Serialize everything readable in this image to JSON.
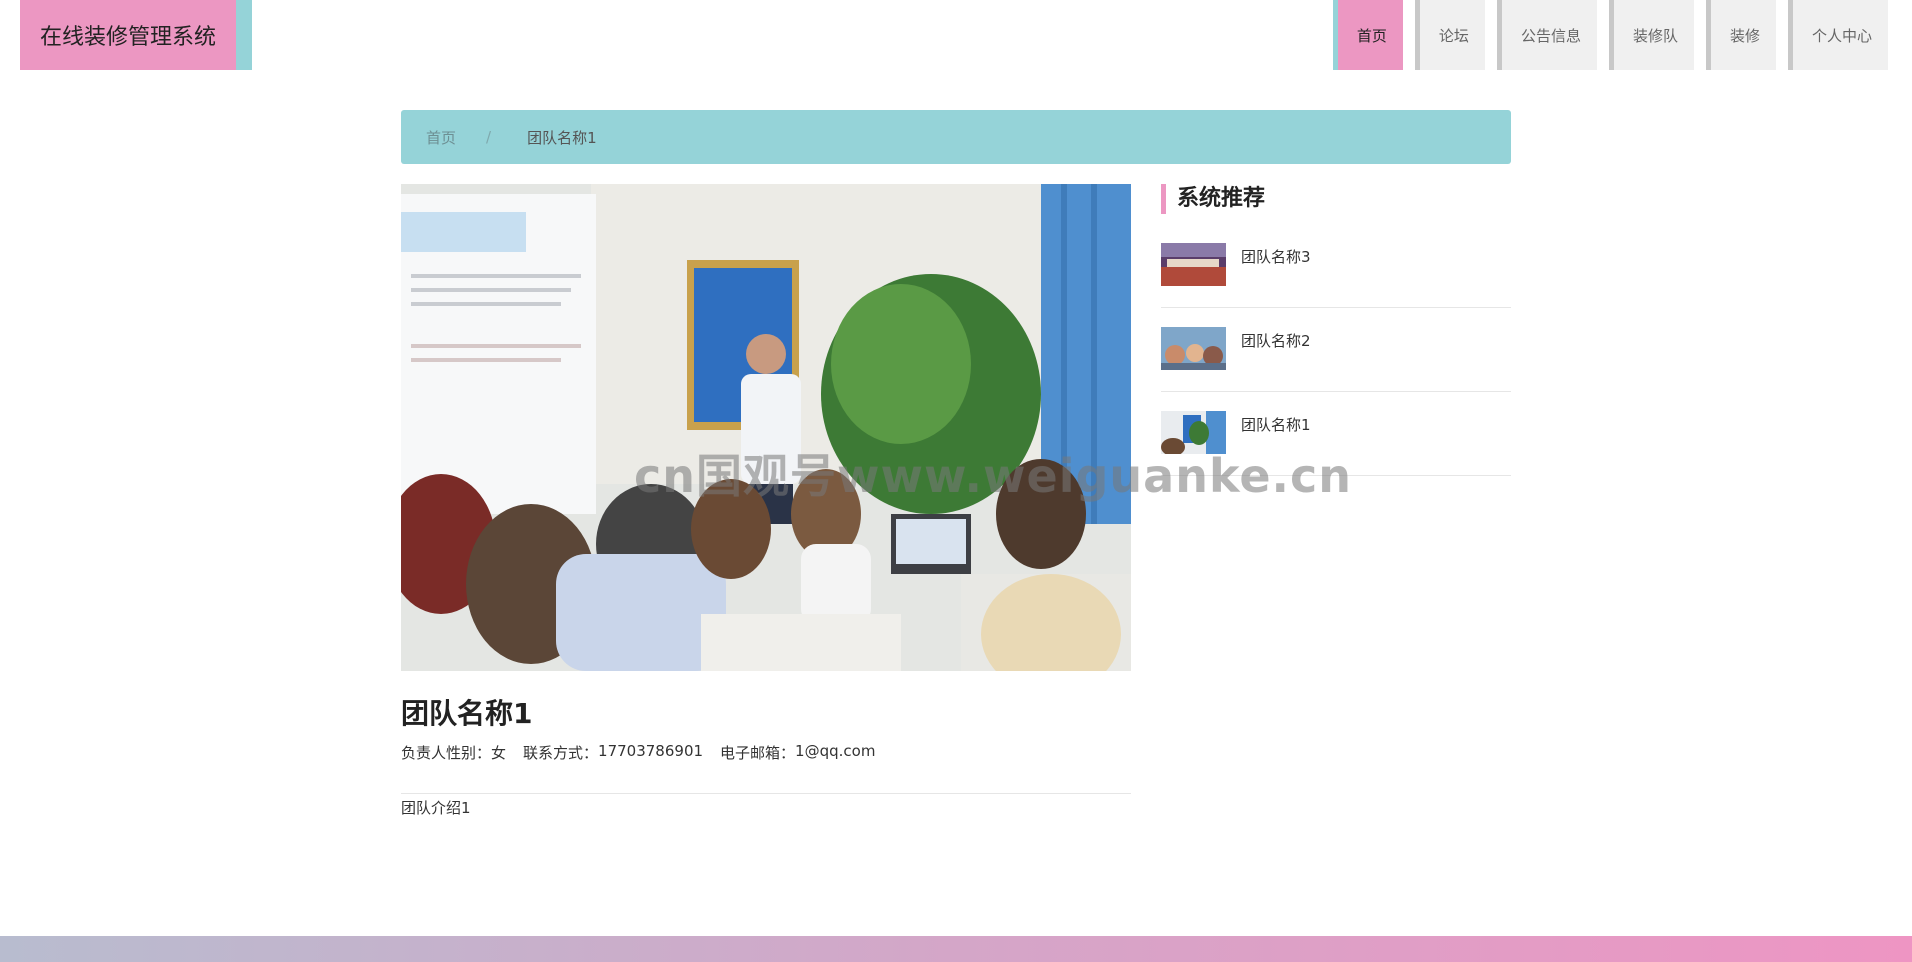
{
  "header": {
    "logo": "在线装修管理系统",
    "nav": [
      {
        "label": "首页",
        "active": true
      },
      {
        "label": "论坛",
        "active": false
      },
      {
        "label": "公告信息",
        "active": false
      },
      {
        "label": "装修队",
        "active": false
      },
      {
        "label": "装修",
        "active": false
      },
      {
        "label": "个人中心",
        "active": false
      }
    ]
  },
  "breadcrumb": {
    "home": "首页",
    "separator": "/",
    "current": "团队名称1"
  },
  "detail": {
    "title": "团队名称1",
    "gender_label": "负责人性别：",
    "gender": "女",
    "contact_label": "联系方式：",
    "contact": "17703786901",
    "email_label": "电子邮箱：",
    "email": "1@qq.com",
    "intro": "团队介绍1"
  },
  "sidebar": {
    "title": "系统推荐",
    "items": [
      {
        "label": "团队名称3"
      },
      {
        "label": "团队名称2"
      },
      {
        "label": "团队名称1"
      }
    ]
  },
  "watermark": "cn国观号www.weiguanke.cn",
  "colors": {
    "primary": "#ec97c2",
    "secondary": "#95d3d8"
  }
}
